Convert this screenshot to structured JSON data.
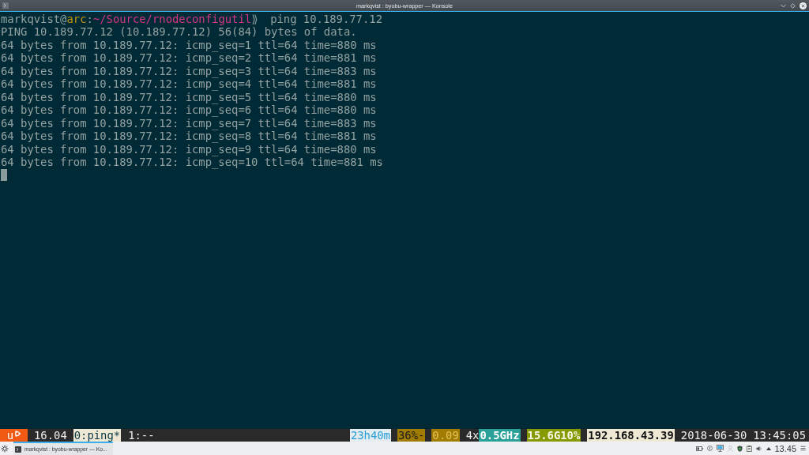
{
  "window": {
    "title": "markqvist : byobu-wrapper — Konsole"
  },
  "terminal": {
    "prompt": {
      "user": "markqvist@",
      "host": "arc",
      "separator": ":",
      "path": "~/Source/rnodeconfigutil",
      "symbol": "⟫",
      "command": "ping 10.189.77.12"
    },
    "output": [
      "PING 10.189.77.12 (10.189.77.12) 56(84) bytes of data.",
      "64 bytes from 10.189.77.12: icmp_seq=1 ttl=64 time=880 ms",
      "64 bytes from 10.189.77.12: icmp_seq=2 ttl=64 time=881 ms",
      "64 bytes from 10.189.77.12: icmp_seq=3 ttl=64 time=883 ms",
      "64 bytes from 10.189.77.12: icmp_seq=4 ttl=64 time=881 ms",
      "64 bytes from 10.189.77.12: icmp_seq=5 ttl=64 time=880 ms",
      "64 bytes from 10.189.77.12: icmp_seq=6 ttl=64 time=880 ms",
      "64 bytes from 10.189.77.12: icmp_seq=7 ttl=64 time=883 ms",
      "64 bytes from 10.189.77.12: icmp_seq=8 ttl=64 time=881 ms",
      "64 bytes from 10.189.77.12: icmp_seq=9 ttl=64 time=880 ms",
      "64 bytes from 10.189.77.12: icmp_seq=10 ttl=64 time=881 ms"
    ]
  },
  "status_bar": {
    "left": [
      {
        "kind": "logo",
        "text": "u",
        "color": "#f05a12"
      },
      {
        "kind": "release",
        "text": "16.04"
      },
      {
        "kind": "window",
        "text": "0:ping*",
        "selected": true
      },
      {
        "kind": "window",
        "text": "1:--",
        "selected": false
      }
    ],
    "right": [
      {
        "kind": "uptime",
        "text": "23h40m",
        "color": "#e3ecef"
      },
      {
        "kind": "battery",
        "text": "36%-",
        "color": "#a07c00"
      },
      {
        "kind": "load",
        "text": "0.09",
        "color": "#a07c00"
      },
      {
        "kind": "cpu_count",
        "text": "4x"
      },
      {
        "kind": "cpu_frequency",
        "text": "0.5GHz",
        "color": "#2aa198"
      },
      {
        "kind": "memory",
        "text": "15.6G10%",
        "color": "#859900"
      },
      {
        "kind": "ip",
        "text": "192.168.43.39",
        "color": "#eee8d5"
      },
      {
        "kind": "date",
        "text": "2018-06-30"
      },
      {
        "kind": "time",
        "text": "13:45:05"
      }
    ]
  },
  "taskbar": {
    "tasks": [
      {
        "title": "markqvist : byobu-wrapper — Ko...",
        "selected": true
      }
    ],
    "clock": "13.45"
  }
}
